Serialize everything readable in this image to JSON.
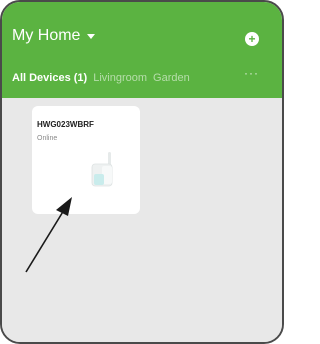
{
  "header": {
    "title": "My Home",
    "add_icon": "plus-icon",
    "more_icon": "ellipsis-icon",
    "tabs": [
      {
        "label": "All Devices (1)",
        "active": true
      },
      {
        "label": "Livingroom",
        "active": false
      },
      {
        "label": "Garden",
        "active": false
      }
    ],
    "more_label": "···"
  },
  "devices": [
    {
      "name": "HWG023WBRF",
      "status": "Online",
      "icon": "wifi-router-icon"
    }
  ],
  "colors": {
    "accent": "#5bb341",
    "content_bg": "#e8e8e8",
    "card_bg": "#ffffff"
  }
}
